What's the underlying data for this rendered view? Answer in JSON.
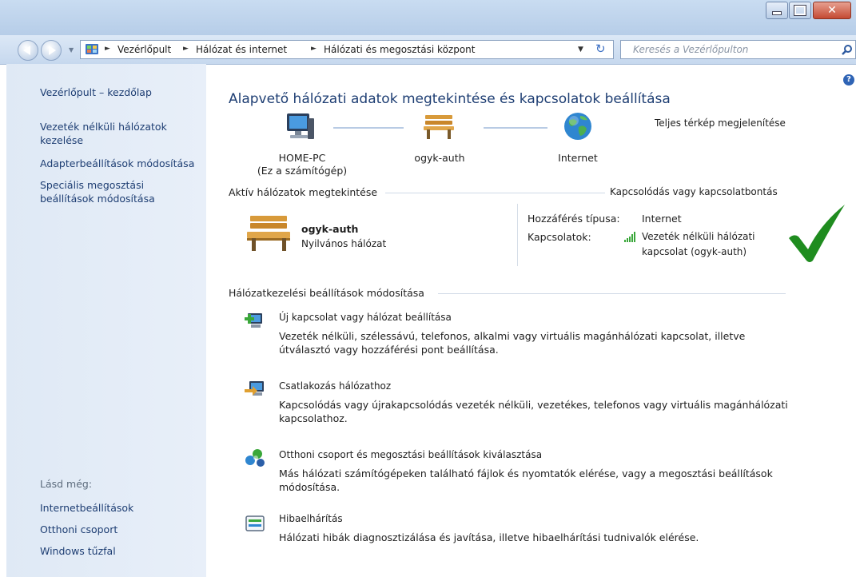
{
  "window": {
    "minimize_icon": "minimize-icon",
    "maximize_icon": "maximize-icon",
    "close_icon": "close-icon"
  },
  "address": {
    "crumbs": [
      "Vezérlőpult",
      "Hálózat és internet",
      "Hálózati és megosztási központ"
    ],
    "search_placeholder": "Keresés a Vezérlőpulton"
  },
  "sidebar": {
    "items": [
      "Vezérlőpult – kezdőlap",
      "Vezeték nélküli hálózatok kezelése",
      "Adapterbeállítások módosítása",
      "Speciális megosztási beállítások módosítása"
    ],
    "see_also_label": "Lásd még:",
    "see_also": [
      "Internetbeállítások",
      "Otthoni csoport",
      "Windows tűzfal"
    ]
  },
  "main": {
    "title": "Alapvető hálózati adatok megtekintése és kapcsolatok beállítása",
    "full_map_link": "Teljes térkép megjelenítése",
    "map": {
      "computer_name": "HOME-PC",
      "computer_sub": "(Ez a számítógép)",
      "network_name": "ogyk-auth",
      "internet": "Internet"
    },
    "active": {
      "section_label": "Aktív hálózatok megtekintése",
      "connect_link": "Kapcsolódás vagy kapcsolatbontás",
      "network_name": "ogyk-auth",
      "network_type": "Nyilvános hálózat",
      "access_label": "Hozzáférés típusa:",
      "access_value": "Internet",
      "connections_label": "Kapcsolatok:",
      "connection_link_line1": "Vezeték nélküli hálózati",
      "connection_link_line2": "kapcsolat (ogyk-auth)"
    },
    "settings": {
      "section_label": "Hálózatkezelési beállítások módosítása",
      "items": [
        {
          "title": "Új kapcsolat vagy hálózat beállítása",
          "desc1": "Vezeték nélküli, szélessávú, telefonos, alkalmi vagy virtuális magánhálózati kapcsolat, illetve",
          "desc2": "útválasztó vagy hozzáférési pont beállítása."
        },
        {
          "title": "Csatlakozás hálózathoz",
          "desc1": "Kapcsolódás vagy újrakapcsolódás vezeték nélküli, vezetékes, telefonos vagy virtuális magánhálózati",
          "desc2": "kapcsolathoz."
        },
        {
          "title": "Otthoni csoport és megosztási beállítások kiválasztása",
          "desc1": "Más hálózati számítógépeken található fájlok és nyomtatók elérése, vagy a megosztási beállítások",
          "desc2": "módosítása."
        },
        {
          "title": "Hibaelhárítás",
          "desc1": "Hálózati hibák diagnosztizálása és javítása, illetve hibaelhárítási tudnivalók elérése.",
          "desc2": ""
        }
      ]
    }
  },
  "colors": {
    "link": "#1f5fb6",
    "checkmark": "#1f8c1f",
    "sidebar_bg": "#e3ecf7"
  }
}
